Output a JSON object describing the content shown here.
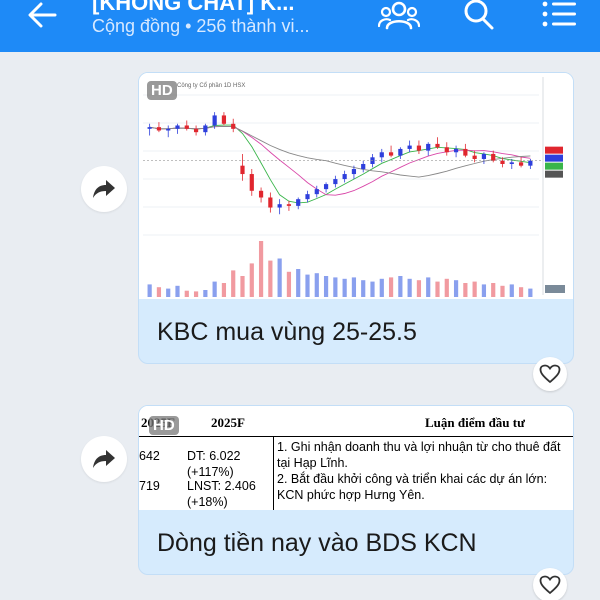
{
  "header": {
    "title": "[KHÔNG CHAT] K...",
    "subtitle": "Cộng đồng • 256 thành vi..."
  },
  "messages": [
    {
      "caption": "KBC mua vùng 25-25.5",
      "badge": "HD",
      "chart_legend": "Công ty Cổ phần  1D  HSX",
      "chart_data": {
        "type": "candlestick",
        "ohlc": [
          [
            28.6,
            28.9,
            28.2,
            28.7
          ],
          [
            28.7,
            29.0,
            28.4,
            28.5
          ],
          [
            28.5,
            28.8,
            28.1,
            28.6
          ],
          [
            28.6,
            28.9,
            28.3,
            28.8
          ],
          [
            28.8,
            29.1,
            28.5,
            28.6
          ],
          [
            28.6,
            28.8,
            28.2,
            28.4
          ],
          [
            28.4,
            28.9,
            28.2,
            28.8
          ],
          [
            28.8,
            29.6,
            28.6,
            29.4
          ],
          [
            29.4,
            29.6,
            28.8,
            28.9
          ],
          [
            28.9,
            29.2,
            28.4,
            28.6
          ],
          [
            26.4,
            27.1,
            25.5,
            25.9
          ],
          [
            25.9,
            26.2,
            24.6,
            24.9
          ],
          [
            24.9,
            25.1,
            24.2,
            24.5
          ],
          [
            24.5,
            24.8,
            23.6,
            23.9
          ],
          [
            23.9,
            24.4,
            23.5,
            24.1
          ],
          [
            24.1,
            24.3,
            23.7,
            24.0
          ],
          [
            24.0,
            24.5,
            23.8,
            24.4
          ],
          [
            24.4,
            24.9,
            24.2,
            24.7
          ],
          [
            24.7,
            25.2,
            24.5,
            25.0
          ],
          [
            25.0,
            25.4,
            24.8,
            25.3
          ],
          [
            25.3,
            25.8,
            25.1,
            25.6
          ],
          [
            25.6,
            26.1,
            25.4,
            25.9
          ],
          [
            25.9,
            26.4,
            25.6,
            26.2
          ],
          [
            26.2,
            26.7,
            26.0,
            26.5
          ],
          [
            26.5,
            27.1,
            26.3,
            26.9
          ],
          [
            26.9,
            27.4,
            26.6,
            27.2
          ],
          [
            27.2,
            27.6,
            26.9,
            27.0
          ],
          [
            27.0,
            27.5,
            26.8,
            27.4
          ],
          [
            27.4,
            27.9,
            27.2,
            27.6
          ],
          [
            27.6,
            27.9,
            27.1,
            27.3
          ],
          [
            27.3,
            27.8,
            27.0,
            27.7
          ],
          [
            27.7,
            28.1,
            27.4,
            27.5
          ],
          [
            27.5,
            27.8,
            27.0,
            27.2
          ],
          [
            27.2,
            27.6,
            26.9,
            27.4
          ],
          [
            27.4,
            27.7,
            26.9,
            27.0
          ],
          [
            27.0,
            27.3,
            26.6,
            26.8
          ],
          [
            26.8,
            27.2,
            26.5,
            27.1
          ],
          [
            27.1,
            27.3,
            26.6,
            26.7
          ],
          [
            26.7,
            26.9,
            26.3,
            26.5
          ],
          [
            26.5,
            26.8,
            26.2,
            26.6
          ],
          [
            26.6,
            26.9,
            26.3,
            26.4
          ],
          [
            26.4,
            26.8,
            26.2,
            26.7
          ]
        ],
        "volume": [
          18,
          14,
          12,
          16,
          9,
          8,
          10,
          22,
          20,
          38,
          30,
          48,
          80,
          52,
          55,
          36,
          40,
          32,
          34,
          30,
          28,
          26,
          28,
          24,
          22,
          26,
          28,
          30,
          26,
          24,
          28,
          22,
          26,
          24,
          20,
          22,
          18,
          20,
          16,
          18,
          14,
          12
        ]
      }
    },
    {
      "caption": "Dòng tiền nay vào BDS KCN",
      "badge": "HD",
      "table": {
        "col1_header": "2025F",
        "col2_header": "2025F",
        "col3_header": "Luận điểm đầu tư",
        "left_val1": "642",
        "left_val2": "719",
        "dt": "DT: 6.022",
        "dt_pct": "(+117%)",
        "lnst": "LNST: 2.406",
        "lnst_pct": "(+18%)",
        "point1": "1. Ghi nhận doanh thu và lợi nhuận từ cho thuê đất tại Hạp Lĩnh.",
        "point2": "2. Bắt đầu khởi công và triển khai các dự án lớn: KCN phức hợp Hưng Yên."
      }
    }
  ],
  "colors": {
    "header_bg": "#1e8af7",
    "bubble_bg": "#d6ebfd",
    "candle_up": "#2e3fdc",
    "candle_down": "#e0262e"
  },
  "icons": {
    "back": "arrow-left-icon",
    "members": "group-icon",
    "search": "search-icon",
    "menu": "list-menu-icon",
    "forward": "share-forward-icon",
    "like": "heart-icon"
  }
}
